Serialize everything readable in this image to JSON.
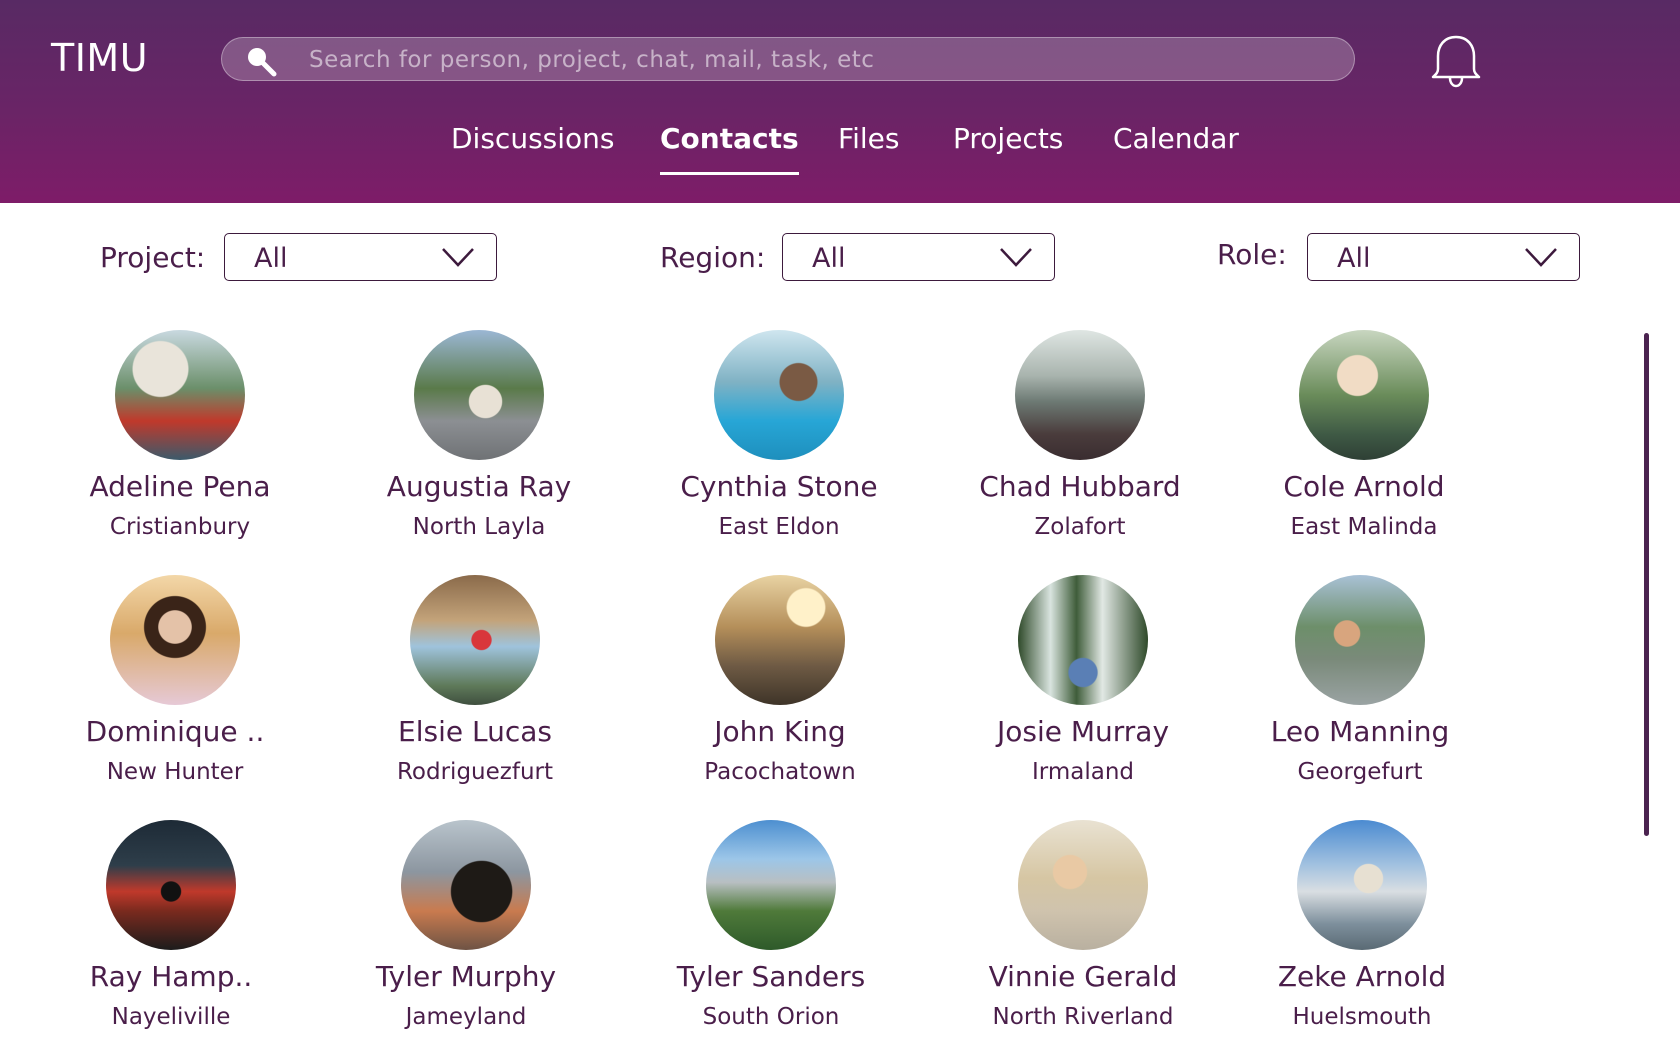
{
  "app": {
    "logo": "TIMU"
  },
  "search": {
    "placeholder": "Search for person, project, chat, mail, task, etc"
  },
  "tabs": [
    {
      "label": "Discussions"
    },
    {
      "label": "Contacts"
    },
    {
      "label": "Files"
    },
    {
      "label": "Projects"
    },
    {
      "label": "Calendar"
    }
  ],
  "active_tab": "Contacts",
  "filters": {
    "project": {
      "label": "Project:",
      "value": "All"
    },
    "region": {
      "label": "Region:",
      "value": "All"
    },
    "role": {
      "label": "Role:",
      "value": "All"
    }
  },
  "contacts": [
    {
      "name": "Adeline Pena",
      "city": "Cristianbury"
    },
    {
      "name": "Augustia Ray",
      "city": "North Layla"
    },
    {
      "name": "Cynthia Stone",
      "city": "East Eldon"
    },
    {
      "name": "Chad Hubbard",
      "city": "Zolafort"
    },
    {
      "name": "Cole Arnold",
      "city": "East Malinda"
    },
    {
      "name": "Dominique ..",
      "city": "New Hunter"
    },
    {
      "name": "Elsie Lucas",
      "city": "Rodriguezfurt"
    },
    {
      "name": "John King",
      "city": "Pacochatown"
    },
    {
      "name": "Josie Murray",
      "city": "Irmaland"
    },
    {
      "name": "Leo Manning",
      "city": "Georgefurt"
    },
    {
      "name": "Ray Hamp..",
      "city": "Nayeliville"
    },
    {
      "name": "Tyler Murphy",
      "city": "Jameyland"
    },
    {
      "name": "Tyler Sanders",
      "city": "South Orion"
    },
    {
      "name": "Vinnie Gerald",
      "city": "North Riverland"
    },
    {
      "name": "Zeke Arnold",
      "city": "Huelsmouth"
    }
  ],
  "colors": {
    "header_top": "#582a64",
    "header_bottom": "#7e1c68",
    "text": "#4a1e4a"
  }
}
